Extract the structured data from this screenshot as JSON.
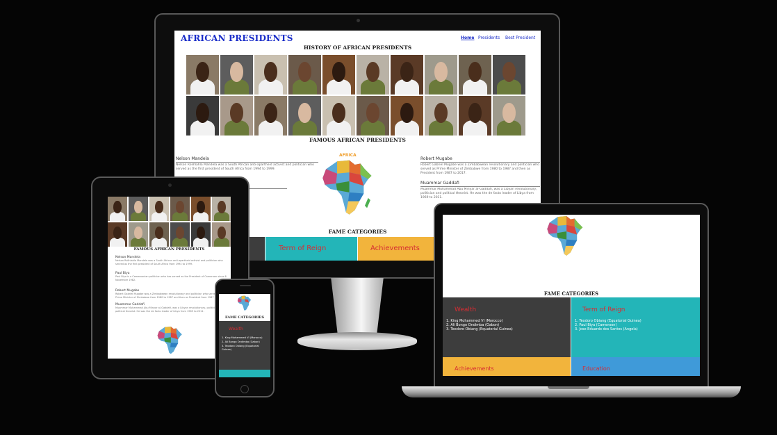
{
  "site": {
    "title": "AFRICAN PRESIDENTS",
    "nav": [
      "Home",
      "Presidents",
      "Best President"
    ],
    "history_heading": "HISTORY OF AFRICAN PRESIDENTS",
    "famous_heading": "FAMOUS AFRICAN PRESIDENTS",
    "fame_heading": "FAME CATEGORIES",
    "map_label": "AFRICA"
  },
  "presidents": [
    {
      "name": "Nelson Mandela",
      "icon": "heart-icon",
      "bio": "Nelson Rolihlahla Mandela was a South African anti-apartheid activist and politician who served as the first president of South Africa from 1994 to 1999."
    },
    {
      "name": "Robert Mugabe",
      "icon": "flag-icon",
      "bio": "Robert Gabriel Mugabe was a Zimbabwean revolutionary and politician who served as Prime Minister of Zimbabwe from 1980 to 1987 and then as President from 1987 to 2017."
    },
    {
      "name": "Muammar Gaddafi",
      "icon": "peace-icon",
      "bio": "Muammar Muhammad Abu Minyar al-Gaddafi, was a Libyan revolutionary, politician and political theorist. He was the de facto leader of Libya from 1969 to 2011."
    },
    {
      "name": "Paul Biya",
      "icon": "person-icon",
      "bio": "Paul Biya is a Cameroonian politician who has served as the President of Cameroon since 6 November 1982."
    }
  ],
  "categories": {
    "wealth": {
      "title": "Wealth",
      "items": [
        "1. King Mohammed VI (Morocco)",
        "2. Ali Bongo Ondimba (Gabon)",
        "3. Teodoro Obiang (Equatorial Guinea)"
      ]
    },
    "term": {
      "title": "Term of Reign",
      "items": [
        "1. Teodoro Obiang (Equatorial Guinea)",
        "2. Paul Biya (Cameroon)",
        "3. Jose Eduardo dos Santos (Angola)"
      ]
    },
    "achievements": {
      "title": "Achievements"
    },
    "education": {
      "title": "Education"
    }
  },
  "colors": {
    "background": "#050505",
    "title_blue": "#1a2dc9",
    "wealth_bg": "#3d3d3d",
    "term_bg": "#23b5b8",
    "achievements_bg": "#f2b43c",
    "education_bg": "#3f9ad9",
    "category_title": "#d62d33"
  }
}
